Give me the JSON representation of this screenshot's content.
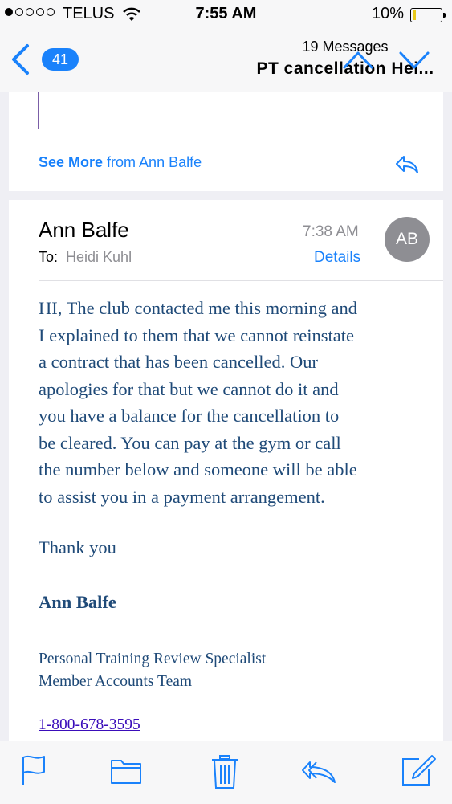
{
  "status_bar": {
    "carrier": "TELUS",
    "time": "7:55 AM",
    "battery_percent": "10%",
    "battery_level": 0.1
  },
  "nav": {
    "back_count": "41",
    "message_count": "19 Messages",
    "subject": "PT cancellation  Hei...",
    "icons": [
      "chevron-left-icon",
      "chevron-up-icon",
      "chevron-down-icon"
    ]
  },
  "previous_message": {
    "see_more_bold": "See More",
    "see_more_rest": " from Ann Balfe"
  },
  "message": {
    "sender": "Ann Balfe",
    "to_label": "To:",
    "to_name": "Heidi Kuhl",
    "time": "7:38 AM",
    "details_label": "Details",
    "avatar_initials": "AB",
    "body": [
      "HI, The club contacted me this morning and",
      "I explained to them that we cannot reinstate",
      "a contract that has been cancelled.  Our",
      "apologies for that but we cannot do it and",
      "you have a balance for the cancellation to",
      "be cleared.  You can pay at the gym or call",
      "the number below and someone will be able",
      "to assist you in a payment arrangement."
    ],
    "thanks": "Thank you",
    "signature_name": "Ann Balfe",
    "signature_title": "Personal Training Review Specialist",
    "signature_team": "Member Accounts Team",
    "phone": "1-800-678-3595"
  },
  "toolbar": {
    "icons": [
      "flag-icon",
      "folder-icon",
      "trash-icon",
      "reply-icon",
      "compose-icon"
    ]
  },
  "colors": {
    "accent": "#1a82fb",
    "body_text": "#1f4a78",
    "avatar_bg": "#8e8e93",
    "battery_fill": "#e8c91a",
    "link_visited": "#3a0dba"
  }
}
